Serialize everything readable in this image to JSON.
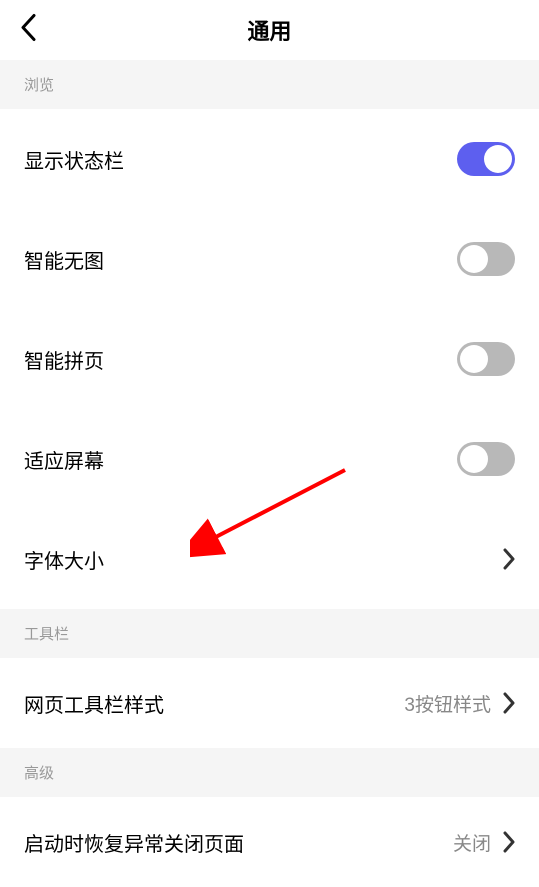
{
  "header": {
    "title": "通用"
  },
  "sections": {
    "browse": {
      "title": "浏览",
      "items": {
        "status_bar": {
          "label": "显示状态栏",
          "toggle_on": true
        },
        "smart_noimage": {
          "label": "智能无图",
          "toggle_on": false
        },
        "smart_paging": {
          "label": "智能拼页",
          "toggle_on": false
        },
        "fit_screen": {
          "label": "适应屏幕",
          "toggle_on": false
        },
        "font_size": {
          "label": "字体大小"
        }
      }
    },
    "toolbar": {
      "title": "工具栏",
      "items": {
        "toolbar_style": {
          "label": "网页工具栏样式",
          "value": "3按钮样式"
        }
      }
    },
    "advanced": {
      "title": "高级",
      "items": {
        "restore_pages": {
          "label": "启动时恢复异常关闭页面",
          "value": "关闭"
        }
      }
    }
  },
  "colors": {
    "accent": "#5d5fef",
    "toggle_off": "#b8b8b8",
    "section_bg": "#f5f5f5",
    "text_secondary": "#999999",
    "text_value": "#888888",
    "arrow": "#ff0000"
  }
}
